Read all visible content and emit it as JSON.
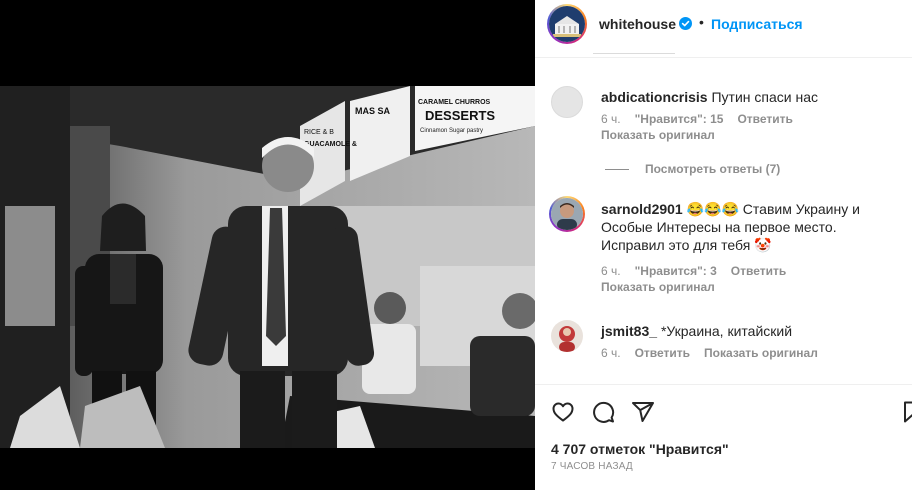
{
  "post": {
    "photo_sign_1": "MAS SA",
    "photo_sign_2": "DESSERTS",
    "photo_sign_3": "GUACAMOLE &",
    "photo_sign_4": "CARAMEL CHURROS",
    "photo_sign_5": "RICE & B",
    "photo_sign_6": "Cinnamon Sugar pastry"
  },
  "header": {
    "username": "whitehouse",
    "dot": "•",
    "follow_label": "Подписаться"
  },
  "comments": [
    {
      "username": "abdicationcrisis",
      "text": "Путин спаси нас",
      "time": "6 ч.",
      "likes": "\"Нравится\": 15",
      "reply": "Ответить",
      "show_original": "Показать оригинал"
    },
    {
      "username": "sarnold2901",
      "text": "😂😂😂 Ставим Украину и Особые Интересы на первое место. Исправил это для тебя 🤡",
      "time": "6 ч.",
      "likes": "\"Нравится\": 3",
      "reply": "Ответить",
      "show_original": "Показать оригинал"
    },
    {
      "username": "jsmit83_",
      "text": "*Украина, китайский",
      "time": "6 ч.",
      "reply": "Ответить",
      "show_original": "Показать оригинал"
    }
  ],
  "view_replies": "Посмотреть ответы (7)",
  "likes_count": "4 707 отметок \"Нравится\"",
  "post_time": "7 ЧАСОВ НАЗАД",
  "icons": {
    "like": "heart-icon",
    "comment": "comment-icon",
    "share": "share-icon",
    "save": "bookmark-icon",
    "verified": "verified-badge-icon"
  },
  "colors": {
    "accent": "#0095f6",
    "muted": "#8e8e8e",
    "text": "#262626"
  }
}
